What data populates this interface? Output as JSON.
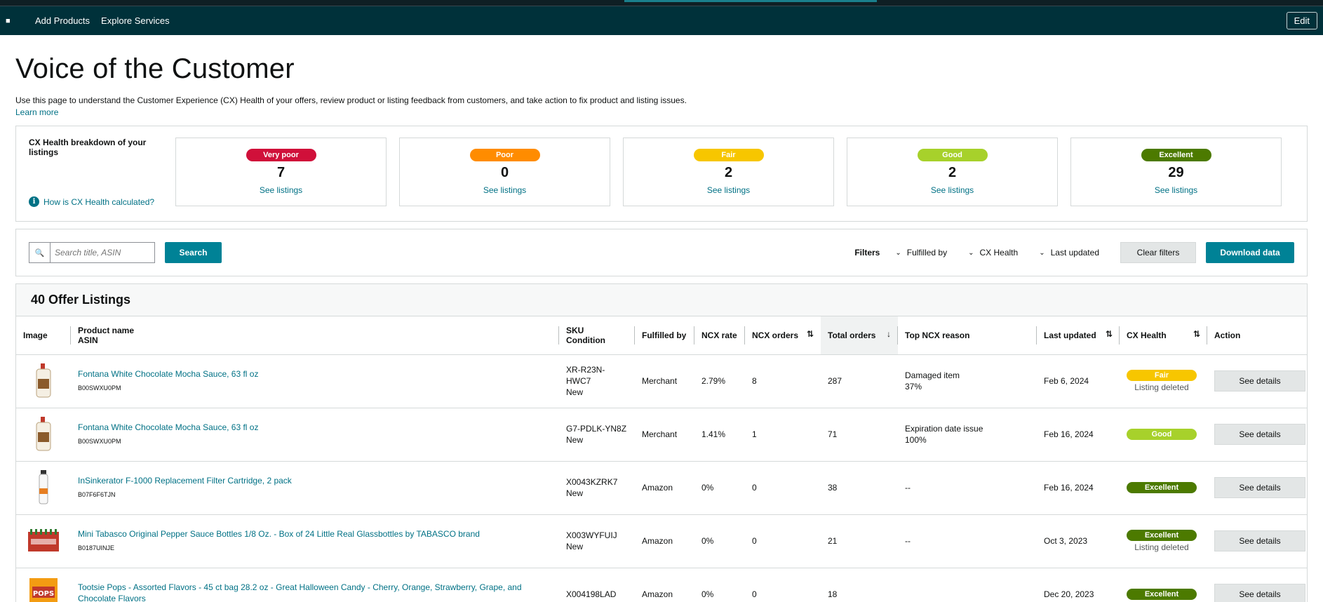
{
  "nav": {
    "add_products": "Add Products",
    "explore_services": "Explore Services",
    "edit": "Edit"
  },
  "page": {
    "title": "Voice of the Customer",
    "intro": "Use this page to understand the Customer Experience (CX) Health of your offers, review product or listing feedback from customers, and take action to fix product and listing issues.",
    "learn_more": "Learn more"
  },
  "health": {
    "title": "CX Health breakdown of your listings",
    "how_link": "How is CX Health calculated?",
    "cards": [
      {
        "label": "Very poor",
        "count": "7",
        "link": "See listings",
        "color": "#d0103a"
      },
      {
        "label": "Poor",
        "count": "0",
        "link": "See listings",
        "color": "#ff8c00"
      },
      {
        "label": "Fair",
        "count": "2",
        "link": "See listings",
        "color": "#f7c600"
      },
      {
        "label": "Good",
        "count": "2",
        "link": "See listings",
        "color": "#a7d12b"
      },
      {
        "label": "Excellent",
        "count": "29",
        "link": "See listings",
        "color": "#4c7a00"
      }
    ]
  },
  "toolbar": {
    "search_placeholder": "Search title, ASIN",
    "search_button": "Search",
    "filters_label": "Filters",
    "filter_fulfilled": "Fulfilled by",
    "filter_health": "CX Health",
    "filter_updated": "Last updated",
    "clear_filters": "Clear filters",
    "download": "Download data"
  },
  "listing": {
    "heading": "40 Offer Listings",
    "columns": {
      "image": "Image",
      "product_name": "Product name",
      "asin": "ASIN",
      "sku": "SKU",
      "condition": "Condition",
      "fulfilled_by": "Fulfilled by",
      "ncx_rate": "NCX rate",
      "ncx_orders": "NCX orders",
      "total_orders": "Total orders",
      "top_reason": "Top NCX reason",
      "last_updated": "Last updated",
      "cx_health": "CX Health",
      "action": "Action"
    },
    "rows": [
      {
        "name": "Fontana White Chocolate Mocha Sauce, 63 fl oz",
        "asin": "B00SWXU0PM",
        "sku": "XR-R23N-HWC7",
        "condition": "New",
        "fulfilled": "Merchant",
        "ncx_rate": "2.79%",
        "ncx_orders": "8",
        "total": "287",
        "reason": "Damaged item",
        "reason_pct": "37%",
        "updated": "Feb 6, 2024",
        "health": "Fair",
        "health_color": "#f7c600",
        "health_sub": "Listing deleted",
        "action": "See details",
        "img": "bottle"
      },
      {
        "name": "Fontana White Chocolate Mocha Sauce, 63 fl oz",
        "asin": "B00SWXU0PM",
        "sku": "G7-PDLK-YN8Z",
        "condition": "New",
        "fulfilled": "Merchant",
        "ncx_rate": "1.41%",
        "ncx_orders": "1",
        "total": "71",
        "reason": "Expiration date issue",
        "reason_pct": "100%",
        "updated": "Feb 16, 2024",
        "health": "Good",
        "health_color": "#a7d12b",
        "health_sub": "",
        "action": "See details",
        "img": "bottle"
      },
      {
        "name": "InSinkerator F-1000 Replacement Filter Cartridge, 2 pack",
        "asin": "B07F6F6TJN",
        "sku": "X0043KZRK7",
        "condition": "New",
        "fulfilled": "Amazon",
        "ncx_rate": "0%",
        "ncx_orders": "0",
        "total": "38",
        "reason": "--",
        "reason_pct": "",
        "updated": "Feb 16, 2024",
        "health": "Excellent",
        "health_color": "#4c7a00",
        "health_sub": "",
        "action": "See details",
        "img": "filter"
      },
      {
        "name": "Mini Tabasco Original Pepper Sauce Bottles 1/8 Oz. - Box of 24 Little Real Glassbottles by TABASCO brand",
        "asin": "B0187UINJE",
        "sku": "X003WYFUIJ",
        "condition": "New",
        "fulfilled": "Amazon",
        "ncx_rate": "0%",
        "ncx_orders": "0",
        "total": "21",
        "reason": "--",
        "reason_pct": "",
        "updated": "Oct 3, 2023",
        "health": "Excellent",
        "health_color": "#4c7a00",
        "health_sub": "Listing deleted",
        "action": "See details",
        "img": "tabasco"
      },
      {
        "name": "Tootsie Pops - Assorted Flavors - 45 ct bag 28.2 oz - Great Halloween Candy - Cherry, Orange, Strawberry, Grape, and Chocolate Flavors",
        "asin": "",
        "sku": "X004198LAD",
        "condition": "",
        "fulfilled": "Amazon",
        "ncx_rate": "0%",
        "ncx_orders": "0",
        "total": "18",
        "reason": "",
        "reason_pct": "",
        "updated": "Dec 20, 2023",
        "health": "Excellent",
        "health_color": "#4c7a00",
        "health_sub": "",
        "action": "See details",
        "img": "pops"
      }
    ]
  }
}
